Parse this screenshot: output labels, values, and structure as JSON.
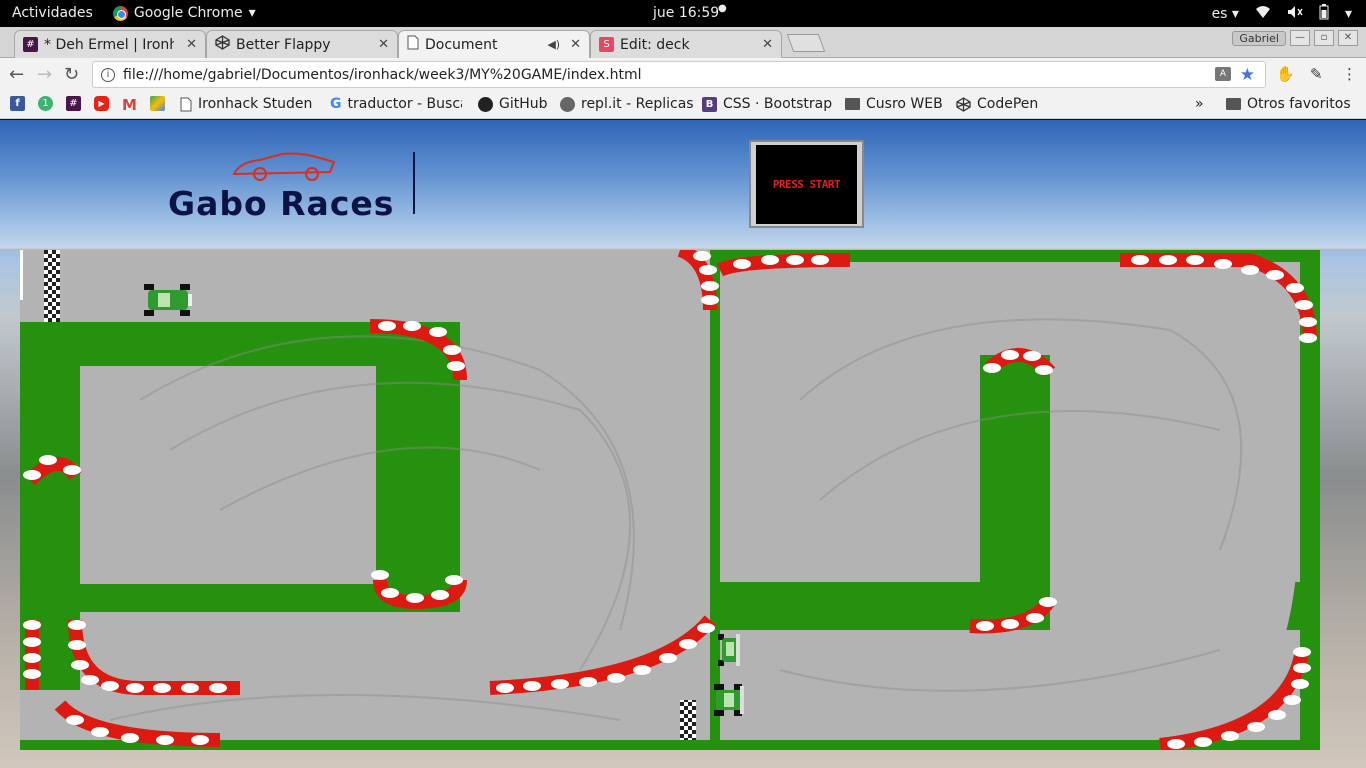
{
  "system_bar": {
    "activities": "Actividades",
    "app_name": "Google Chrome",
    "clock": "jue 16:59",
    "language": "es"
  },
  "tabs": [
    {
      "label": "* Deh Ermel | Ironh",
      "favicon": "slack-icon",
      "color": "#4a154b"
    },
    {
      "label": "Better Flappy",
      "favicon": "codepen-icon",
      "color": "#333333"
    },
    {
      "label": "Document",
      "favicon": "document-icon",
      "color": "#666666",
      "active": true
    },
    {
      "label": "Edit: deck",
      "favicon": "slides-icon",
      "color": "#e8475f"
    }
  ],
  "window": {
    "profile": "Gabriel"
  },
  "address_bar": {
    "url": "file:///home/gabriel/Documentos/ironhack/week3/MY%20GAME/index.html"
  },
  "bookmarks": [
    {
      "label": "Ironhack Student",
      "icon": "document-icon"
    },
    {
      "label": "traductor - Busca",
      "icon": "google-icon"
    },
    {
      "label": "GitHub",
      "icon": "github-icon"
    },
    {
      "label": "repl.it - Replicas",
      "icon": "replit-icon"
    },
    {
      "label": "CSS · Bootstrap",
      "icon": "bootstrap-icon"
    },
    {
      "label": "Cusro WEB",
      "icon": "folder-icon"
    },
    {
      "label": "CodePen",
      "icon": "codepen-icon"
    }
  ],
  "other_bookmarks": "Otros favoritos",
  "game": {
    "title": "Gabo Races",
    "start_label": "PRESS START",
    "track_color": "#25910f",
    "asphalt_color": "#b3b3b3",
    "curb_color": "#dd1a12"
  }
}
